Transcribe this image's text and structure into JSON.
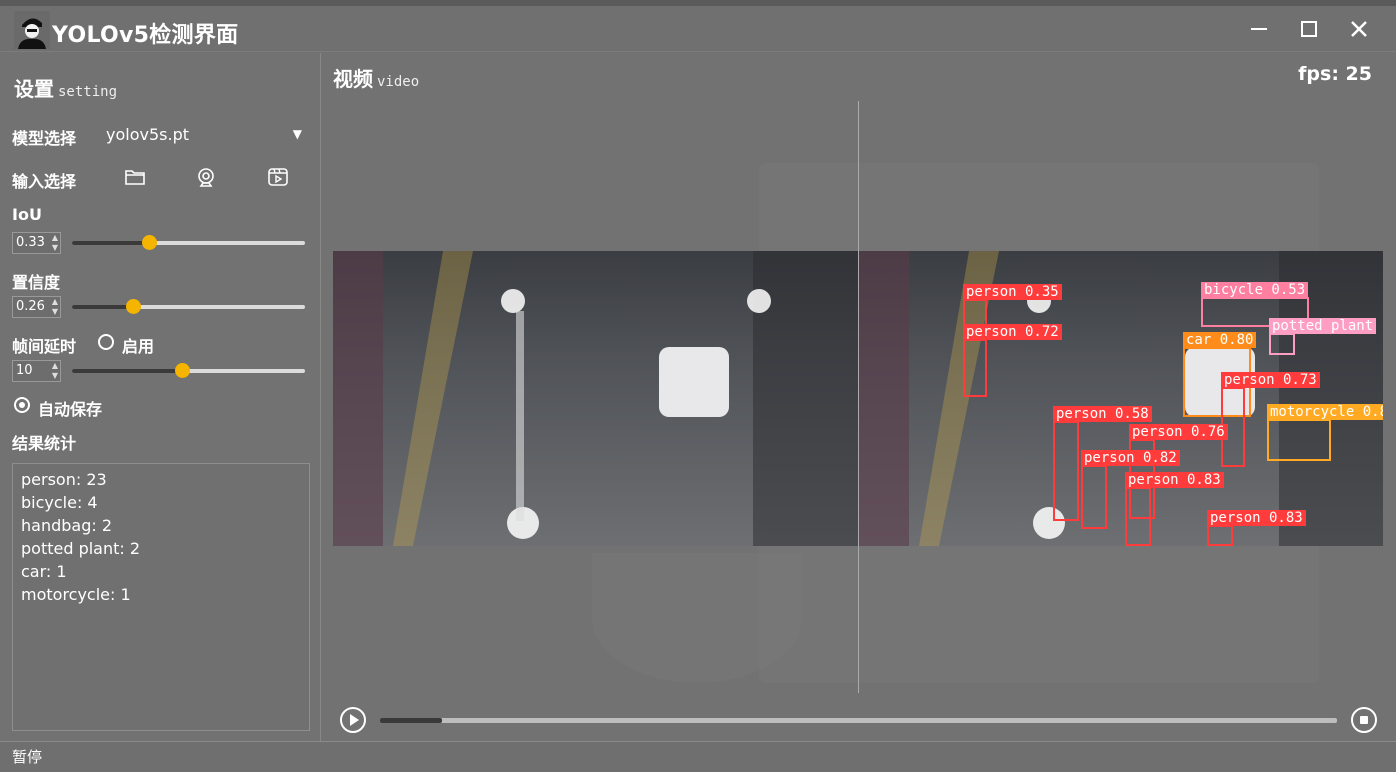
{
  "window": {
    "title": "YOLOv5检测界面"
  },
  "settings": {
    "title_cn": "设置",
    "title_en": "setting",
    "model_label": "模型选择",
    "model_value": "yolov5s.pt",
    "input_label": "输入选择",
    "iou_label": "IoU",
    "iou_value": "0.33",
    "iou_level": 0.33,
    "conf_label": "置信度",
    "conf_value": "0.26",
    "conf_level": 0.26,
    "delay_label": "帧间延时",
    "delay_enable_label": "启用",
    "delay_value": "10",
    "delay_level": 0.47,
    "autosave_label": "自动保存",
    "stats_title": "结果统计",
    "stats": [
      "person: 23",
      "bicycle: 4",
      "handbag: 2",
      "potted plant: 2",
      "car: 1",
      "motorcycle: 1"
    ]
  },
  "video": {
    "title_cn": "视频",
    "title_en": "video",
    "fps_text": "fps: 25",
    "progress": 0.065
  },
  "detections": [
    {
      "label": "person 0.35"
    },
    {
      "label": "person 0.72"
    },
    {
      "label": "bicycle 0.53"
    },
    {
      "label": "car 0.80"
    },
    {
      "label": "person 0.73"
    },
    {
      "label": "person 0.58"
    },
    {
      "label": "person 0.76"
    },
    {
      "label": "person 0.82"
    },
    {
      "label": "person 0.83"
    },
    {
      "label": "person 0.83"
    },
    {
      "label": "potted plant"
    },
    {
      "label": "motorcycle 0.8"
    }
  ],
  "status": {
    "text": "暂停"
  },
  "colors": {
    "accent": "#f5b400",
    "box": "#ff3b3b"
  }
}
